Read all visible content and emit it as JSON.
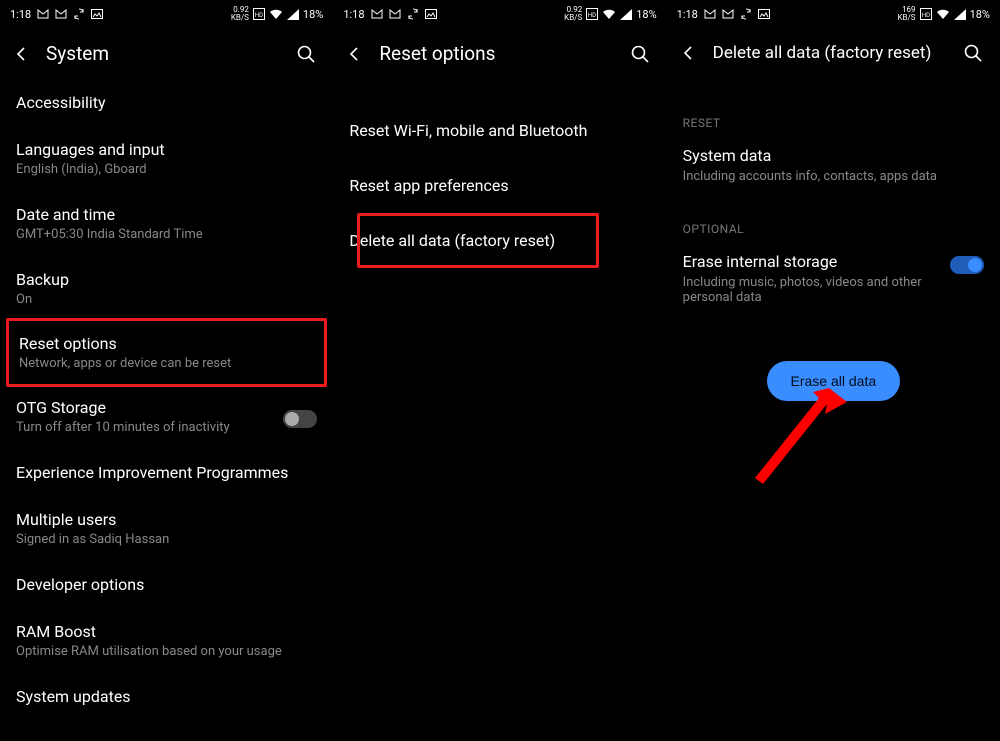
{
  "status": {
    "time": "1:18",
    "net_rate_a": "0.92",
    "net_rate_unit": "KB/S",
    "net_rate_b": "169",
    "battery": "18%"
  },
  "panel1": {
    "title": "System",
    "items": [
      {
        "title": "Accessibility",
        "sub": ""
      },
      {
        "title": "Languages and input",
        "sub": "English (India), Gboard"
      },
      {
        "title": "Date and time",
        "sub": "GMT+05:30 India Standard Time"
      },
      {
        "title": "Backup",
        "sub": "On"
      },
      {
        "title": "Reset options",
        "sub": "Network, apps or device can be reset"
      },
      {
        "title": "OTG Storage",
        "sub": "Turn off after 10 minutes of inactivity"
      },
      {
        "title": "Experience Improvement Programmes",
        "sub": ""
      },
      {
        "title": "Multiple users",
        "sub": "Signed in as Sadiq Hassan"
      },
      {
        "title": "Developer options",
        "sub": ""
      },
      {
        "title": "RAM Boost",
        "sub": "Optimise RAM utilisation based on your usage"
      },
      {
        "title": "System updates",
        "sub": ""
      }
    ]
  },
  "panel2": {
    "title": "Reset options",
    "items": [
      {
        "title": "Reset Wi-Fi, mobile and Bluetooth"
      },
      {
        "title": "Reset app preferences"
      },
      {
        "title": "Delete all data (factory reset)"
      }
    ]
  },
  "panel3": {
    "title": "Delete all data (factory reset)",
    "section_reset": "RESET",
    "system_data_title": "System data",
    "system_data_sub": "Including accounts info, contacts, apps data",
    "section_optional": "OPTIONAL",
    "erase_storage_title": "Erase internal storage",
    "erase_storage_sub": "Including music, photos, videos and other personal data",
    "button": "Erase all data"
  }
}
